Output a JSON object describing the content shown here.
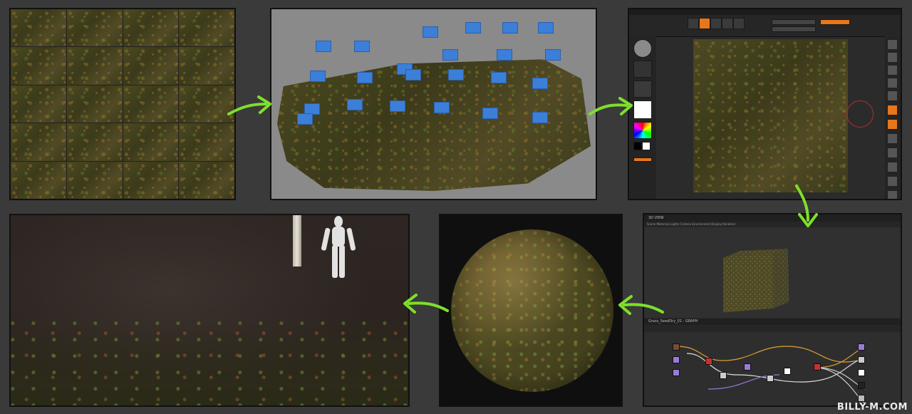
{
  "watermark": "BILLY-M.COM",
  "substance_panel": {
    "view_title": "3D VIEW",
    "view_menu": "Scene  Materials  Lights  Camera  Environment  Display  Renderer",
    "graph_title": "Grass_SeedDry_01 - GRAPH"
  },
  "colors": {
    "arrow": "#7ee02a",
    "camera_marker": "#3c7fd8",
    "zbrush_accent": "#e8761a"
  }
}
